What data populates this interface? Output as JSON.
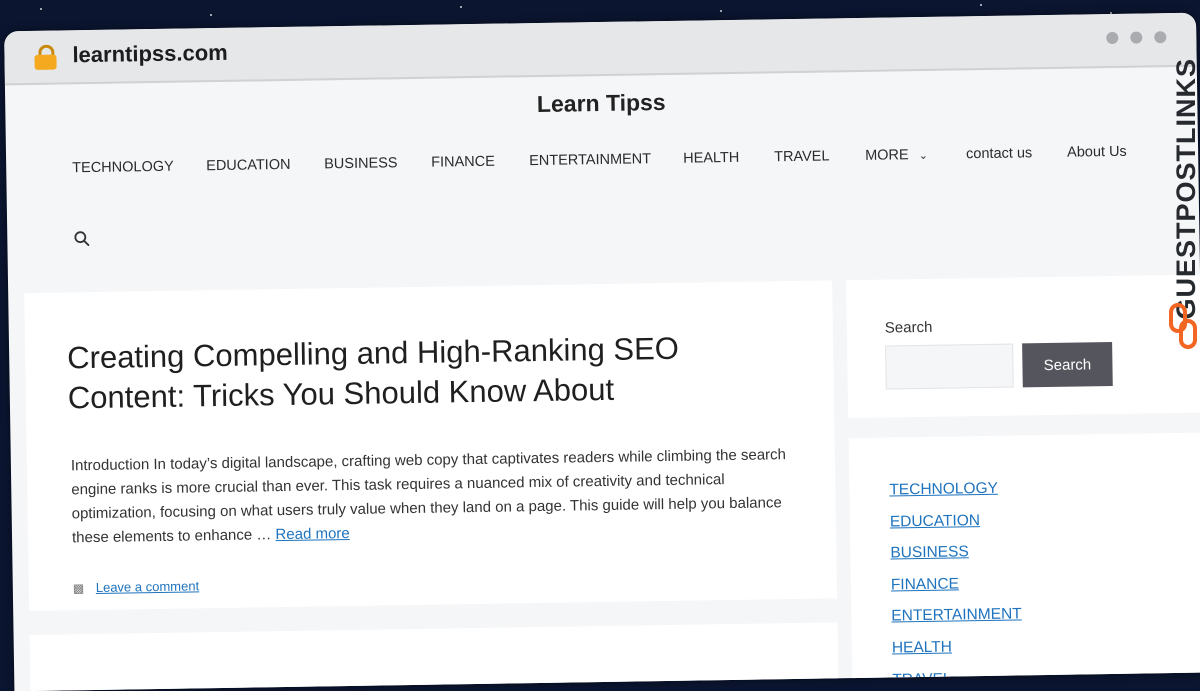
{
  "browser": {
    "url": "learntipss.com"
  },
  "site": {
    "title": "Learn Tipss"
  },
  "nav": {
    "items": [
      "TECHNOLOGY",
      "EDUCATION",
      "BUSINESS",
      "FINANCE",
      "ENTERTAINMENT",
      "HEALTH",
      "TRAVEL",
      "MORE",
      "contact us",
      "About Us"
    ]
  },
  "post": {
    "title": "Creating Compelling and High-Ranking SEO Content: Tricks You Should Know About",
    "excerpt": "Introduction In today’s digital landscape, crafting web copy that captivates readers while climbing the search engine ranks is more crucial than ever. This task requires a nuanced mix of creativity and technical optimization, focusing on what users truly value when they land on a page. This guide will help you balance these elements to enhance …",
    "read_more": "Read more",
    "comment_link": "Leave a comment"
  },
  "sidebar": {
    "search_label": "Search",
    "search_button": "Search",
    "categories": [
      "TECHNOLOGY",
      "EDUCATION",
      "BUSINESS",
      "FINANCE",
      "ENTERTAINMENT",
      "HEALTH",
      "TRAVEL"
    ]
  },
  "watermark": {
    "text": "GUESTPOSTLINKS"
  },
  "colors": {
    "link": "#1e73be",
    "button": "#55555e",
    "accent": "#f26522",
    "background": "#0b1530"
  },
  "icons": [
    "lock-icon",
    "search-icon",
    "chevron-down-icon",
    "comments-icon",
    "link-logo-icon"
  ]
}
